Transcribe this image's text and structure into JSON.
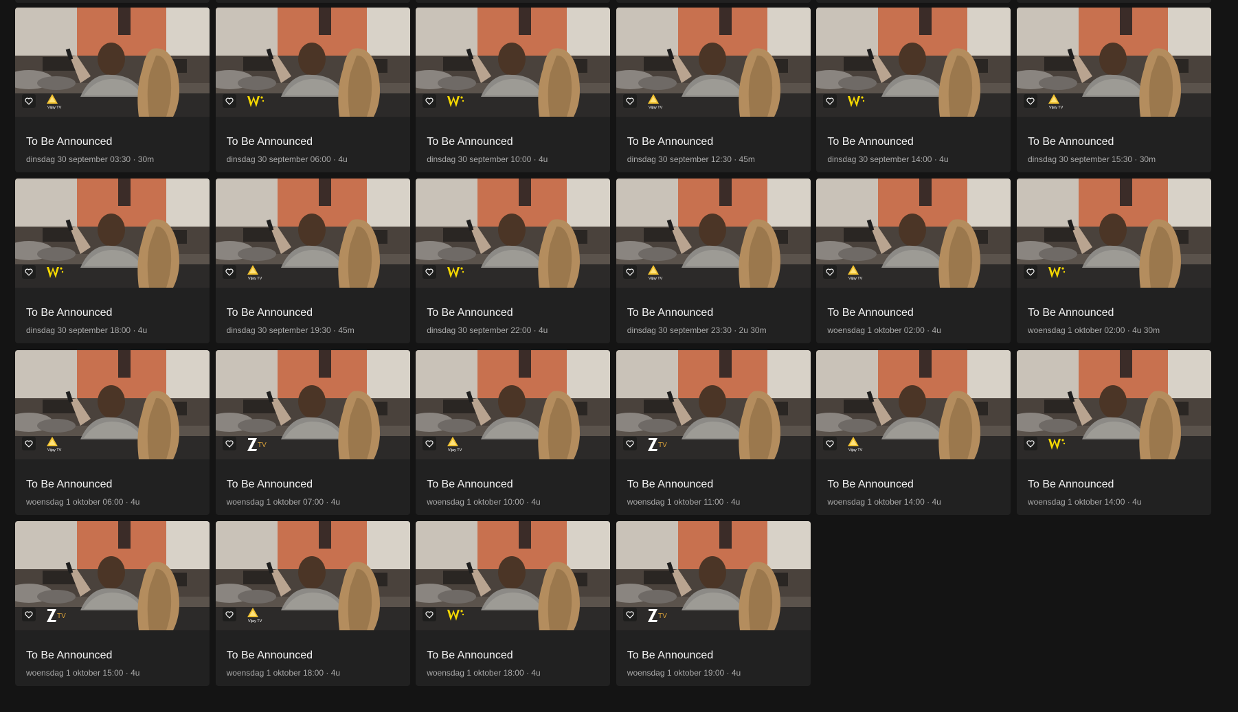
{
  "colors": {
    "page_bg": "#141414",
    "card_bg": "#212121",
    "title": "#f2f2f2",
    "meta": "#a9a9a9",
    "vijay_gold": "#f2c230",
    "w_yellow": "#f5d800"
  },
  "cards": [
    {
      "title": "To Be Announced",
      "meta": "dinsdag 30 september 03:30 · 30m",
      "channel": "vijay-tv",
      "logo_text": "Vijay TV"
    },
    {
      "title": "To Be Announced",
      "meta": "dinsdag 30 september 06:00 · 4u",
      "channel": "w"
    },
    {
      "title": "To Be Announced",
      "meta": "dinsdag 30 september 10:00 · 4u",
      "channel": "w"
    },
    {
      "title": "To Be Announced",
      "meta": "dinsdag 30 september 12:30 · 45m",
      "channel": "vijay-tv",
      "logo_text": "Vijay TV"
    },
    {
      "title": "To Be Announced",
      "meta": "dinsdag 30 september 14:00 · 4u",
      "channel": "w"
    },
    {
      "title": "To Be Announced",
      "meta": "dinsdag 30 september 15:30 · 30m",
      "channel": "vijay-tv",
      "logo_text": "Vijay TV"
    },
    {
      "title": "To Be Announced",
      "meta": "dinsdag 30 september 18:00 · 4u",
      "channel": "w"
    },
    {
      "title": "To Be Announced",
      "meta": "dinsdag 30 september 19:30 · 45m",
      "channel": "vijay-tv",
      "logo_text": "Vijay TV"
    },
    {
      "title": "To Be Announced",
      "meta": "dinsdag 30 september 22:00 · 4u",
      "channel": "w"
    },
    {
      "title": "To Be Announced",
      "meta": "dinsdag 30 september 23:30 · 2u 30m",
      "channel": "vijay-tv",
      "logo_text": "Vijay TV"
    },
    {
      "title": "To Be Announced",
      "meta": "woensdag 1 oktober 02:00 · 4u",
      "channel": "vijay-tv",
      "logo_text": "Vijay TV"
    },
    {
      "title": "To Be Announced",
      "meta": "woensdag 1 oktober 02:00 · 4u 30m",
      "channel": "w"
    },
    {
      "title": "To Be Announced",
      "meta": "woensdag 1 oktober 06:00 · 4u",
      "channel": "vijay-tv",
      "logo_text": "Vijay TV"
    },
    {
      "title": "To Be Announced",
      "meta": "woensdag 1 oktober 07:00 · 4u",
      "channel": "z-tv",
      "logo_text": "TV"
    },
    {
      "title": "To Be Announced",
      "meta": "woensdag 1 oktober 10:00 · 4u",
      "channel": "vijay-tv",
      "logo_text": "Vijay TV"
    },
    {
      "title": "To Be Announced",
      "meta": "woensdag 1 oktober 11:00 · 4u",
      "channel": "z-tv",
      "logo_text": "TV"
    },
    {
      "title": "To Be Announced",
      "meta": "woensdag 1 oktober 14:00 · 4u",
      "channel": "vijay-tv",
      "logo_text": "Vijay TV"
    },
    {
      "title": "To Be Announced",
      "meta": "woensdag 1 oktober 14:00 · 4u",
      "channel": "w"
    },
    {
      "title": "To Be Announced",
      "meta": "woensdag 1 oktober 15:00 · 4u",
      "channel": "z-tv",
      "logo_text": "TV"
    },
    {
      "title": "To Be Announced",
      "meta": "woensdag 1 oktober 18:00 · 4u",
      "channel": "vijay-tv",
      "logo_text": "Vijay TV"
    },
    {
      "title": "To Be Announced",
      "meta": "woensdag 1 oktober 18:00 · 4u",
      "channel": "w"
    },
    {
      "title": "To Be Announced",
      "meta": "woensdag 1 oktober 19:00 · 4u",
      "channel": "z-tv",
      "logo_text": "TV"
    }
  ],
  "icons": {
    "favorite": "heart-outline-icon",
    "thumbnail": "couple-watching-tv-image"
  }
}
